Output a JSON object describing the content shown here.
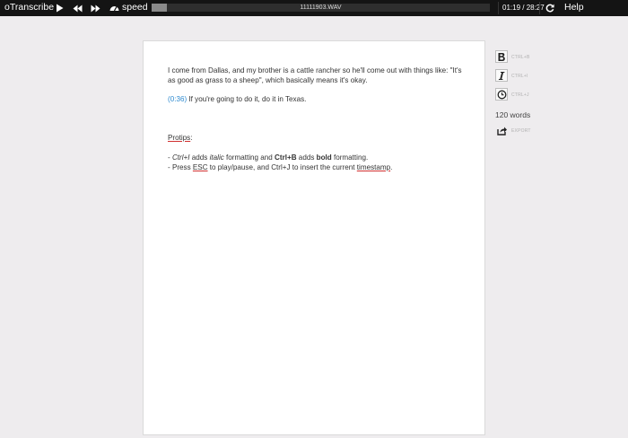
{
  "app": {
    "name": "oTranscribe",
    "speed_label": "speed",
    "filename": "11111903.WAV",
    "time": "01:19 / 28:27",
    "help_label": "Help",
    "progress": 0.046
  },
  "document": {
    "para1": "I come from Dallas, and my brother is a cattle rancher so he'll come out with things like: \"It's as good as grass to a sheep\", which basically means it's okay.",
    "timestamp": "0:36",
    "para2": "If you're going to do it, do it in Texas.",
    "protips_label": "Protips",
    "protips_colon": ":",
    "tip1": {
      "prefix": "- ",
      "italic_shortcut": "Ctrl+I",
      "mid1": " adds ",
      "italic_word": "italic",
      "mid2": " formatting and ",
      "bold_shortcut": "Ctrl+B",
      "mid3": " adds ",
      "bold_word": "bold",
      "suffix": " formatting."
    },
    "tip2": {
      "prefix": "- Press ",
      "esc": "ESC",
      "mid": " to play/pause, and Ctrl+J to insert the current ",
      "timestamp_word": "timestamp",
      "suffix": "."
    }
  },
  "sidebar": {
    "bold_hint": "CTRL+B",
    "italic_hint": "CTRL+I",
    "timestamp_hint": "CTRL+J",
    "word_count": "120 words",
    "export_label": "EXPORT"
  },
  "icons": {
    "play": "play-icon",
    "rewind": "rewind-icon",
    "fast_forward": "fast-forward-icon",
    "speed": "speedometer-icon",
    "reset": "refresh-icon",
    "bold": "bold-icon",
    "italic": "italic-icon",
    "timestamp": "clock-icon",
    "export": "export-icon"
  },
  "colors": {
    "topbar": "#141414",
    "background": "#eeecee",
    "timestamp_link": "#2f8bd0",
    "spellcheck_underline": "#d03030"
  }
}
